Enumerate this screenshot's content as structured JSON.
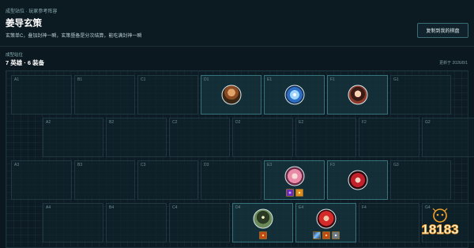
{
  "header": {
    "breadcrumb": "成型站位 · 玩家参考阵容",
    "title": "姜导玄策",
    "description": "玄策单C，叠加封神一瞬，玄策暨备是分次结算，能吃满封神一瞬",
    "copy_button": "复制到我的棋盘"
  },
  "board_section": {
    "title": "成型站位",
    "summary": "7 英雄 · 6 装备",
    "updated": "更新于 2026/8/1"
  },
  "grid": {
    "rows": [
      {
        "cells": [
          {
            "label": "A1"
          },
          {
            "label": "B1"
          },
          {
            "label": "C1"
          },
          {
            "label": "D1",
            "hero": "hero-warrior"
          },
          {
            "label": "E1",
            "hero": "hero-ice-dragon"
          },
          {
            "label": "F1",
            "hero": "hero-girl"
          },
          {
            "label": "G1"
          }
        ]
      },
      {
        "cells": [
          {
            "label": "A2"
          },
          {
            "label": "B2"
          },
          {
            "label": "C2"
          },
          {
            "label": "D2"
          },
          {
            "label": "E2"
          },
          {
            "label": "F2"
          },
          {
            "label": "G2"
          }
        ]
      },
      {
        "cells": [
          {
            "label": "A3"
          },
          {
            "label": "B3"
          },
          {
            "label": "C3"
          },
          {
            "label": "D3"
          },
          {
            "label": "E3",
            "hero": "hero-pink-hair",
            "items": [
              "item-purple-orb",
              "item-gold-flame"
            ]
          },
          {
            "label": "F3",
            "hero": "hero-red-dancer"
          },
          {
            "label": "G3"
          }
        ]
      },
      {
        "cells": [
          {
            "label": "A4"
          },
          {
            "label": "B4"
          },
          {
            "label": "C4"
          },
          {
            "label": "D4",
            "hero": "hero-hooded-mage",
            "items": [
              "item-fire-gem"
            ]
          },
          {
            "label": "E4",
            "hero": "hero-xuance",
            "items": [
              "item-blue-blade",
              "item-fire-gem",
              "item-gray-shield"
            ]
          },
          {
            "label": "F4"
          },
          {
            "label": "G4"
          }
        ]
      }
    ]
  },
  "watermark": {
    "text": "18183"
  },
  "colors": {
    "background": "#0b1820",
    "board": "#0d1c24",
    "filled_border": "#37737b",
    "item_border": "#8a6a2c",
    "logo_orange": "#f2a12a"
  }
}
